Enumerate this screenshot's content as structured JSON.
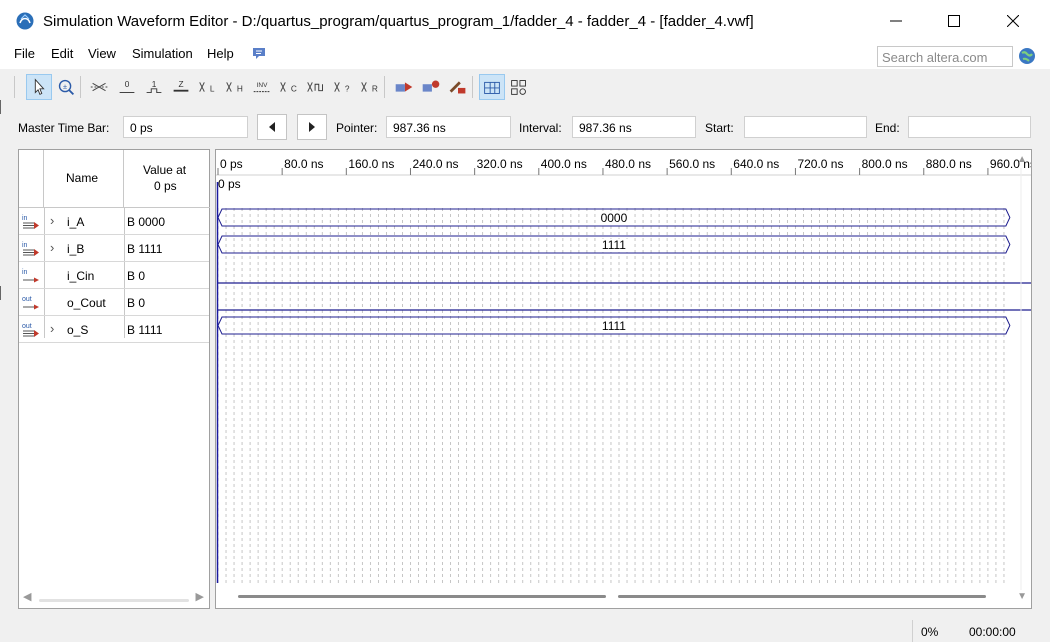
{
  "window": {
    "title": "Simulation Waveform Editor - D:/quartus_program/quartus_program_1/fadder_4 - fadder_4 - [fadder_4.vwf]"
  },
  "menu": {
    "items": [
      "File",
      "Edit",
      "View",
      "Simulation",
      "Help"
    ]
  },
  "search": {
    "placeholder": "Search altera.com"
  },
  "toolbar": {
    "tools": [
      {
        "icon": "selection-pointer-icon",
        "active": true
      },
      {
        "icon": "zoom-tool-icon"
      },
      {
        "icon": "forcing-unknown-icon"
      },
      {
        "icon": "forcing-low-icon"
      },
      {
        "icon": "forcing-high-icon"
      },
      {
        "icon": "high-impedance-icon"
      },
      {
        "icon": "weak-low-icon"
      },
      {
        "icon": "weak-high-icon"
      },
      {
        "icon": "invert-icon"
      },
      {
        "icon": "count-value-icon"
      },
      {
        "icon": "overwrite-clock-icon"
      },
      {
        "icon": "random-values-icon"
      },
      {
        "icon": "value-x-icon"
      },
      {
        "icon": "run-functional-simulation-icon"
      },
      {
        "icon": "run-timing-simulation-icon"
      },
      {
        "icon": "generate-netlist-icon"
      },
      {
        "icon": "snap-to-grid-icon",
        "active": true
      },
      {
        "icon": "grid-settings-icon"
      }
    ]
  },
  "timebar": {
    "master_label": "Master Time Bar:",
    "master_value": "0 ps",
    "pointer_label": "Pointer:",
    "pointer_value": "987.36 ns",
    "interval_label": "Interval:",
    "interval_value": "987.36 ns",
    "start_label": "Start:",
    "start_value": "",
    "end_label": "End:",
    "end_value": ""
  },
  "signal_table": {
    "header_name": "Name",
    "header_value_line1": "Value at",
    "header_value_line2": "0 ps",
    "signals": [
      {
        "name": "i_A",
        "value": "B 0000",
        "dir": "in",
        "bus": true,
        "wave": "0000"
      },
      {
        "name": "i_B",
        "value": "B 1111",
        "dir": "in",
        "bus": true,
        "wave": "1111"
      },
      {
        "name": "i_Cin",
        "value": "B 0",
        "dir": "in",
        "bus": false,
        "level": 0
      },
      {
        "name": "o_Cout",
        "value": "B 0",
        "dir": "out",
        "bus": false,
        "level": 0
      },
      {
        "name": "o_S",
        "value": "B 1111",
        "dir": "out",
        "bus": true,
        "wave": "1111"
      }
    ]
  },
  "time_axis": {
    "ticks": [
      "0 ps",
      "80.0 ns",
      "160.0 ns",
      "240.0 ns",
      "320.0 ns",
      "400.0 ns",
      "480.0 ns",
      "560.0 ns",
      "640.0 ns",
      "720.0 ns",
      "800.0 ns",
      "880.0 ns",
      "960.0 ns"
    ],
    "marker_label": "0 ps"
  },
  "status": {
    "progress": "0%",
    "elapsed": "00:00:00"
  },
  "colors": {
    "wave": "#1f1f8f",
    "selection": "#cce4f7",
    "marker": "#1a1aa0"
  }
}
